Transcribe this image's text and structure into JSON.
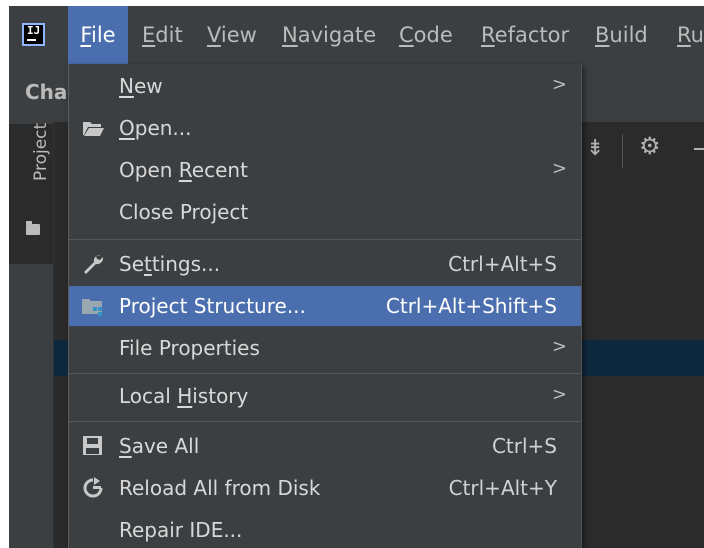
{
  "menubar": {
    "logo": "IJ",
    "items": [
      {
        "label": "File",
        "mnemonic": "F",
        "rest": "ile"
      },
      {
        "label": "Edit",
        "mnemonic": "E",
        "rest": "dit"
      },
      {
        "label": "View",
        "mnemonic": "V",
        "rest": "iew"
      },
      {
        "label": "Navigate",
        "mnemonic": "N",
        "rest": "avigate"
      },
      {
        "label": "Code",
        "mnemonic": "C",
        "rest": "ode"
      },
      {
        "label": "Refactor",
        "mnemonic": "R",
        "rest": "efactor"
      },
      {
        "label": "Build",
        "mnemonic": "B",
        "rest": "uild"
      },
      {
        "label": "Ru",
        "mnemonic": "R",
        "rest": "u"
      }
    ]
  },
  "toolwindow": {
    "partial_tab": "Cha",
    "project_tab": "Project"
  },
  "file_menu": {
    "new": {
      "pre": "",
      "mn": "N",
      "post": "ew"
    },
    "open": {
      "pre": "",
      "mn": "O",
      "post": "pen..."
    },
    "open_recent": {
      "pre": "Open ",
      "mn": "R",
      "post": "ecent"
    },
    "close_project": "Close Project",
    "settings": {
      "pre": "Se",
      "mn": "t",
      "post": "tings...",
      "shortcut": "Ctrl+Alt+S"
    },
    "project_structure": {
      "label": "Project Structure...",
      "shortcut": "Ctrl+Alt+Shift+S"
    },
    "file_properties": "File Properties",
    "local_history": {
      "pre": "Local ",
      "mn": "H",
      "post": "istory"
    },
    "save_all": {
      "pre": "",
      "mn": "S",
      "post": "ave All",
      "shortcut": "Ctrl+S"
    },
    "reload_all": {
      "label": "Reload All from Disk",
      "shortcut": "Ctrl+Alt+Y"
    },
    "repair_ide": "Repair IDE..."
  },
  "colors": {
    "selection": "#4b6eaf",
    "background": "#3c3f41",
    "editor": "#2b2b2b"
  }
}
